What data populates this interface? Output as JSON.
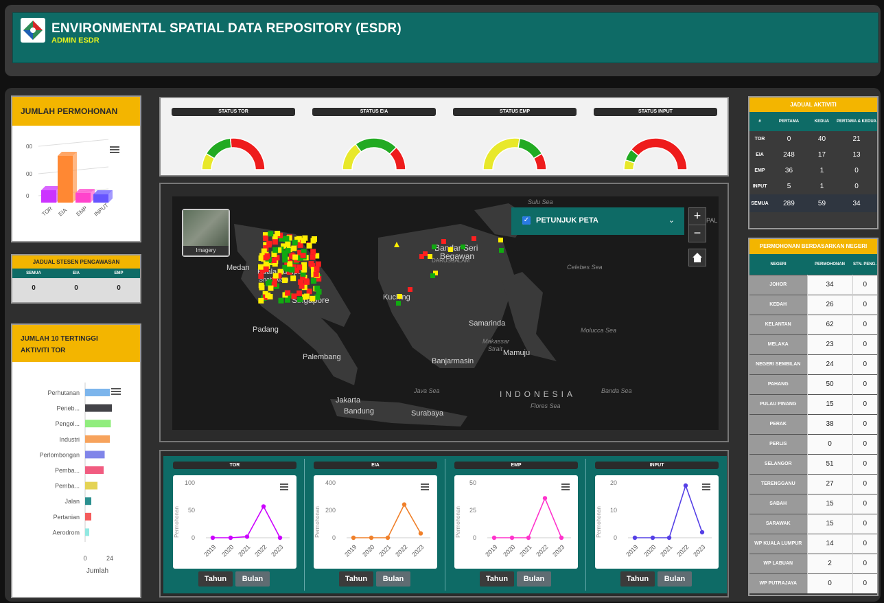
{
  "header": {
    "title": "ENVIRONMENTAL SPATIAL DATA REPOSITORY (ESDR)",
    "subtitle": "ADMIN ESDR"
  },
  "jumlah_permohonan": {
    "title": "JUMLAH PERMOHONAN",
    "chart_data": {
      "type": "bar",
      "categories": [
        "TOR",
        "EIA",
        "EMP",
        "INPUT"
      ],
      "y_tick_labels": [
        "00",
        "00",
        "0"
      ],
      "colors": [
        "#cc33ff",
        "#ff8833",
        "#ff44cc",
        "#6655ff"
      ]
    }
  },
  "jadual_stesen": {
    "title": "JADUAL STESEN PENGAWASAN",
    "headers": [
      "SEMUA",
      "EIA",
      "EMP"
    ],
    "values": [
      "0",
      "0",
      "0"
    ]
  },
  "top10": {
    "title_line1": "JUMLAH 10 TERTINGGI",
    "title_line2": "AKTIVITI TOR",
    "chart_data": {
      "type": "bar",
      "orientation": "horizontal",
      "categories": [
        "Perhutanan",
        "Peneb...",
        "Pengol...",
        "Industri",
        "Perlombongan",
        "Pemba...",
        "Pemba...",
        "Jalan",
        "Pertanian",
        "Aerodrom"
      ],
      "values": [
        24,
        26,
        25,
        24,
        19,
        18,
        12,
        6,
        6,
        4
      ],
      "colors": [
        "#7cb5ec",
        "#434348",
        "#90ed7d",
        "#f7a35c",
        "#8085e9",
        "#f15c80",
        "#e4d354",
        "#2b908f",
        "#f45b5b",
        "#91e8e1"
      ],
      "xticks": [
        "0",
        "24"
      ],
      "xlabel": "Jumlah"
    }
  },
  "gauges": [
    {
      "label": "STATUS TOR",
      "segments": [
        0.17,
        0.3,
        0.53
      ]
    },
    {
      "label": "STATUS EIA",
      "segments": [
        0.3,
        0.45,
        0.25
      ]
    },
    {
      "label": "STATUS EMP",
      "segments": [
        0.55,
        0.28,
        0.17
      ]
    },
    {
      "label": "STATUS INPUT",
      "segments": [
        0.1,
        0.12,
        0.78
      ]
    }
  ],
  "map": {
    "basemap_label": "Imagery",
    "legend_label": "PETUNJUK PETA",
    "zoom_in": "+",
    "zoom_out": "−",
    "cities": [
      "Medan",
      "Kuala Lumpur",
      "Shah Alam",
      "Singapore",
      "Padang",
      "Palembang",
      "Jakarta",
      "Bandung",
      "Surabaya",
      "Kuching",
      "Bandar Seri",
      "Begawan",
      "DARUSSALAM",
      "Samarinda",
      "Mamuju",
      "Banjarmasin",
      "INDONESIA"
    ],
    "seas": [
      "Sulu Sea",
      "Celebes Sea",
      "Molucca Sea",
      "Makassar",
      "Strait",
      "Java Sea",
      "Flores Sea",
      "Banda Sea"
    ],
    "edge_label": "PAL"
  },
  "trend_charts": [
    {
      "title": "TOR",
      "ylabel": "Permohonan",
      "yticks": [
        "100",
        "50",
        "0"
      ],
      "ymax": 100,
      "color": "#cc00ff",
      "x": [
        "2019",
        "2020",
        "2021",
        "2022",
        "2023"
      ],
      "values": [
        0,
        0,
        2,
        57,
        0
      ]
    },
    {
      "title": "EIA",
      "ylabel": "Permohonan",
      "yticks": [
        "400",
        "200",
        "0"
      ],
      "ymax": 400,
      "color": "#f0802a",
      "x": [
        "2019",
        "2020",
        "2021",
        "2022",
        "2023"
      ],
      "values": [
        0,
        0,
        0,
        242,
        32
      ]
    },
    {
      "title": "EMP",
      "ylabel": "Permohonan",
      "yticks": [
        "50",
        "25",
        "0"
      ],
      "ymax": 50,
      "color": "#ff33cc",
      "x": [
        "2019",
        "2020",
        "2021",
        "2022",
        "2023"
      ],
      "values": [
        0,
        0,
        0,
        36,
        0
      ]
    },
    {
      "title": "INPUT",
      "ylabel": "Permohonan",
      "yticks": [
        "20",
        "10",
        "0"
      ],
      "ymax": 20,
      "color": "#5540e6",
      "x": [
        "2019",
        "2020",
        "2021",
        "2022",
        "2023"
      ],
      "values": [
        0,
        0,
        0,
        19,
        2
      ]
    }
  ],
  "buttons": {
    "tahun": "Tahun",
    "bulan": "Bulan"
  },
  "jadual_aktiviti": {
    "title": "JADUAL AKTIVITI",
    "headers": [
      "#",
      "PERTAMA",
      "KEDUA",
      "PERTAMA & KEDUA"
    ],
    "rows": [
      [
        "TOR",
        "0",
        "40",
        "21"
      ],
      [
        "EIA",
        "248",
        "17",
        "13"
      ],
      [
        "EMP",
        "36",
        "1",
        "0"
      ],
      [
        "INPUT",
        "5",
        "1",
        "0"
      ],
      [
        "SEMUA",
        "289",
        "59",
        "34"
      ]
    ]
  },
  "negeri": {
    "title": "PERMOHONAN BERDASARKAN NEGERI",
    "headers": [
      "NEGERI",
      "PERMOHONAN",
      "STN. PENG."
    ],
    "rows": [
      [
        "JOHOR",
        "34",
        "0"
      ],
      [
        "KEDAH",
        "26",
        "0"
      ],
      [
        "KELANTAN",
        "62",
        "0"
      ],
      [
        "MELAKA",
        "23",
        "0"
      ],
      [
        "NEGERI SEMBILAN",
        "24",
        "0"
      ],
      [
        "PAHANG",
        "50",
        "0"
      ],
      [
        "PULAU PINANG",
        "15",
        "0"
      ],
      [
        "PERAK",
        "38",
        "0"
      ],
      [
        "PERLIS",
        "0",
        "0"
      ],
      [
        "SELANGOR",
        "51",
        "0"
      ],
      [
        "TERENGGANU",
        "27",
        "0"
      ],
      [
        "SABAH",
        "15",
        "0"
      ],
      [
        "SARAWAK",
        "15",
        "0"
      ],
      [
        "WP KUALA LUMPUR",
        "14",
        "0"
      ],
      [
        "WP LABUAN",
        "2",
        "0"
      ],
      [
        "WP PUTRAJAYA",
        "0",
        "0"
      ]
    ]
  }
}
